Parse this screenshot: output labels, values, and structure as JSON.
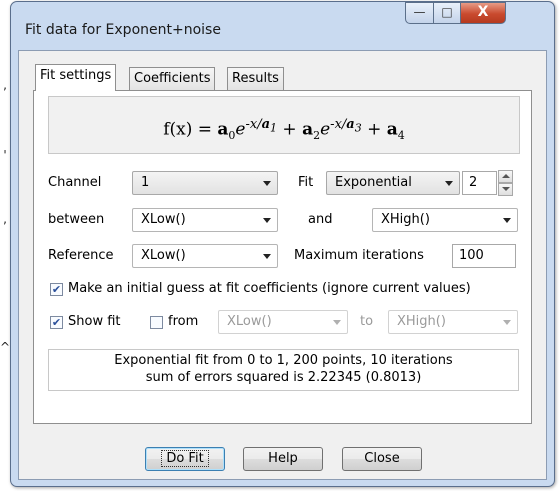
{
  "window": {
    "title": "Fit data for Exponent+noise",
    "close_label": "X"
  },
  "edge_marks": [
    ",",
    "'",
    ",",
    "^"
  ],
  "tabs": [
    {
      "label": "Fit settings",
      "active": true
    },
    {
      "label": "Coefficients",
      "active": false
    },
    {
      "label": "Results",
      "active": false
    }
  ],
  "formula": {
    "lhs": "f(x) = ",
    "a0": "a",
    "s0": "0",
    "e1": "e",
    "exp1_x": "-x/",
    "exp1_a": "a",
    "exp1_s": "1",
    "plus1": " + ",
    "a2": "a",
    "s2": "2",
    "e2": "e",
    "exp2_x": "-x/",
    "exp2_a": "a",
    "exp2_s": "3",
    "plus2": " + ",
    "a4": "a",
    "s4": "4"
  },
  "form": {
    "channel_label": "Channel",
    "channel_value": "1",
    "fit_label": "Fit",
    "fit_value": "Exponential",
    "fit_order": "2",
    "between_label": "between",
    "between_value": "XLow()",
    "and_label": "and",
    "and_value": "XHigh()",
    "reference_label": "Reference",
    "reference_value": "XLow()",
    "max_iter_label": "Maximum iterations",
    "max_iter_value": "100",
    "guess_label": "Make an initial guess at fit coefficients (ignore current values)",
    "guess_checked": true,
    "showfit_label": "Show fit",
    "showfit_checked": true,
    "from_label": "from",
    "from_checked": false,
    "from_value": "XLow()",
    "to_label": "to",
    "to_value": "XHigh()"
  },
  "status": {
    "line1": "Exponential fit from 0 to 1, 200 points, 10 iterations",
    "line2": "sum of errors squared is 2.22345 (0.8013)"
  },
  "buttons": {
    "dofit": "Do Fit",
    "help": "Help",
    "close": "Close"
  },
  "colors": {
    "frame": "#c9daf0",
    "close_button": "#c94a2e",
    "check_mark": "#2a4f9a"
  }
}
